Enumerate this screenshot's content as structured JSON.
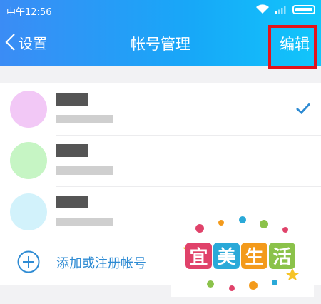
{
  "status_bar": {
    "time": "中午12:56"
  },
  "nav": {
    "back_label": "设置",
    "title": "帐号管理",
    "edit_label": "编辑"
  },
  "accounts": [
    {
      "avatar_color": "#f2c8f6",
      "selected": true
    },
    {
      "avatar_color": "#c6f5c4",
      "selected": false
    },
    {
      "avatar_color": "#d2f2fb",
      "selected": false
    }
  ],
  "add_account": {
    "label": "添加或注册帐号"
  },
  "watermark": {
    "text": [
      "宜",
      "美",
      "生",
      "活"
    ],
    "colors": [
      "#e0426a",
      "#2aa9d8",
      "#f39a1b",
      "#8bc24a"
    ]
  },
  "colors": {
    "accent": "#2e8bd3",
    "highlight": "#e3131b"
  }
}
